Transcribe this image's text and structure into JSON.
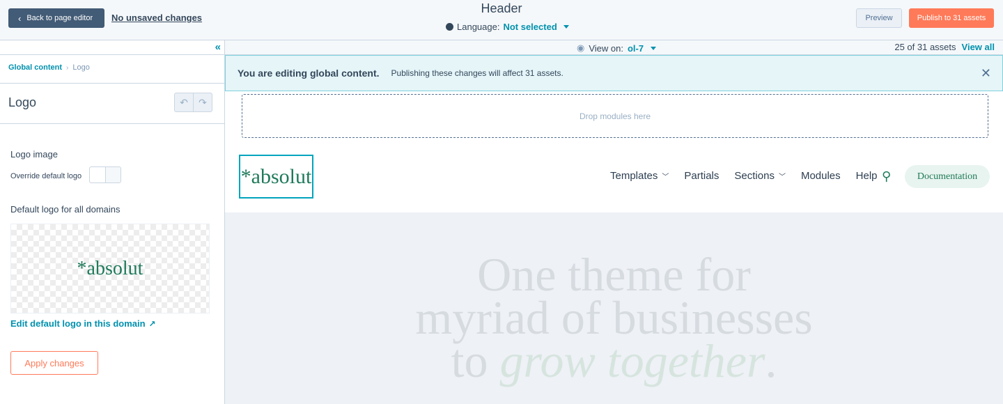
{
  "topbar": {
    "back_label": "Back to page editor",
    "unsaved_label": "No unsaved changes",
    "title": "Header",
    "language_label": "Language:",
    "language_value": "Not selected",
    "preview_label": "Preview",
    "publish_label": "Publish to 31 assets"
  },
  "sidebar": {
    "breadcrumb": {
      "parent": "Global content",
      "current": "Logo"
    },
    "title": "Logo",
    "logo_image_label": "Logo image",
    "override_label": "Override default logo",
    "override_enabled": false,
    "default_logo_label": "Default logo for all domains",
    "logo_preview_text": "*absolut",
    "edit_link_label": "Edit default logo in this domain",
    "apply_label": "Apply changes"
  },
  "viewbar": {
    "view_on_label": "View on:",
    "view_on_value": "ol-7",
    "count_label": "25 of 31 assets",
    "view_all_label": "View all"
  },
  "notice": {
    "strong": "You are editing global content.",
    "text": "Publishing these changes will affect 31 assets."
  },
  "canvas": {
    "dropzone_label": "Drop modules here",
    "site_logo_text": "*absolut",
    "nav": [
      {
        "label": "Templates",
        "has_dropdown": true
      },
      {
        "label": "Partials",
        "has_dropdown": false
      },
      {
        "label": "Sections",
        "has_dropdown": true
      },
      {
        "label": "Modules",
        "has_dropdown": false
      },
      {
        "label": "Help",
        "has_dropdown": false
      }
    ],
    "doc_button_label": "Documentation",
    "hero": {
      "line1": "One theme for",
      "line2": "myriad of businesses",
      "line3_prefix": "to ",
      "line3_italic": "grow together",
      "line3_suffix": "."
    }
  },
  "colors": {
    "accent": "#0091ae",
    "publish": "#ff7a59",
    "brand_green": "#1f7a5a",
    "notice_bg": "#e5f5f8"
  }
}
